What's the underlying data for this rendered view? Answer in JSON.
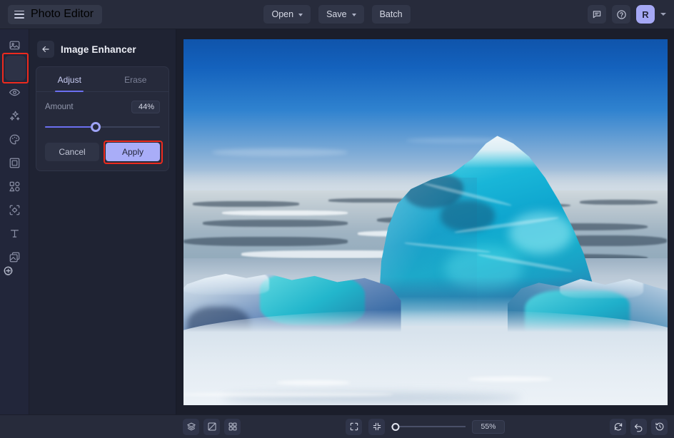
{
  "app": {
    "brand_label": "Photo Editor",
    "menu_icon": "hamburger-icon"
  },
  "topbar": {
    "open_label": "Open",
    "save_label": "Save",
    "batch_label": "Batch",
    "feedback_icon": "chat-bubble-icon",
    "help_icon": "question-circle-icon",
    "avatar_initial": "R",
    "avatar_color": "#a5a8f5"
  },
  "sidebar": {
    "items": [
      {
        "name": "sidebar-item-image",
        "icon": "image-icon",
        "active": false
      },
      {
        "name": "sidebar-item-adjust",
        "icon": "sliders-icon",
        "active": true
      },
      {
        "name": "sidebar-item-retouch",
        "icon": "eye-icon",
        "active": false
      },
      {
        "name": "sidebar-item-effects",
        "icon": "sparkles-icon",
        "active": false
      },
      {
        "name": "sidebar-item-color",
        "icon": "palette-icon",
        "active": false
      },
      {
        "name": "sidebar-item-frame",
        "icon": "frame-icon",
        "active": false
      },
      {
        "name": "sidebar-item-shapes",
        "icon": "shapes-icon",
        "active": false
      },
      {
        "name": "sidebar-item-ai-tools",
        "icon": "ai-crop-icon",
        "active": false
      },
      {
        "name": "sidebar-item-text",
        "icon": "text-icon",
        "active": false
      },
      {
        "name": "sidebar-item-layers",
        "icon": "layers-copy-icon",
        "active": false
      }
    ],
    "highlight_color": "#ed2a1e"
  },
  "panel": {
    "back_icon": "arrow-left-icon",
    "title": "Image Enhancer",
    "tabs": [
      {
        "label": "Adjust",
        "active": true
      },
      {
        "label": "Erase",
        "active": false
      }
    ],
    "amount_label": "Amount",
    "amount_value": "44%",
    "amount_percent": 44,
    "cancel_label": "Cancel",
    "apply_label": "Apply",
    "apply_highlight_color": "#ed2a1e",
    "apply_bg_color": "#a9adf8",
    "accent_color": "#6b6ff0"
  },
  "canvas": {
    "image_description": "Turquoise translucent iceberg on a frozen sea under a deep blue sky"
  },
  "bottombar": {
    "left_tools": [
      {
        "name": "layers-button",
        "icon": "layers-icon"
      },
      {
        "name": "compare-button",
        "icon": "compare-split-icon"
      },
      {
        "name": "grid-button",
        "icon": "grid-icon"
      }
    ],
    "fit_icon": "fit-screen-icon",
    "actual_size_icon": "collapse-arrows-icon",
    "zoom_out_icon": "minus-circle-icon",
    "zoom_in_icon": "plus-circle-icon",
    "zoom_value": "55%",
    "zoom_slider_percent": 6,
    "right_tools": [
      {
        "name": "reset-button",
        "icon": "refresh-icon",
        "dimmed": false
      },
      {
        "name": "undo-button",
        "icon": "undo-icon",
        "dimmed": false
      },
      {
        "name": "redo-button",
        "icon": "redo-icon",
        "dimmed": true
      },
      {
        "name": "history-button",
        "icon": "history-icon",
        "dimmed": false
      }
    ]
  }
}
